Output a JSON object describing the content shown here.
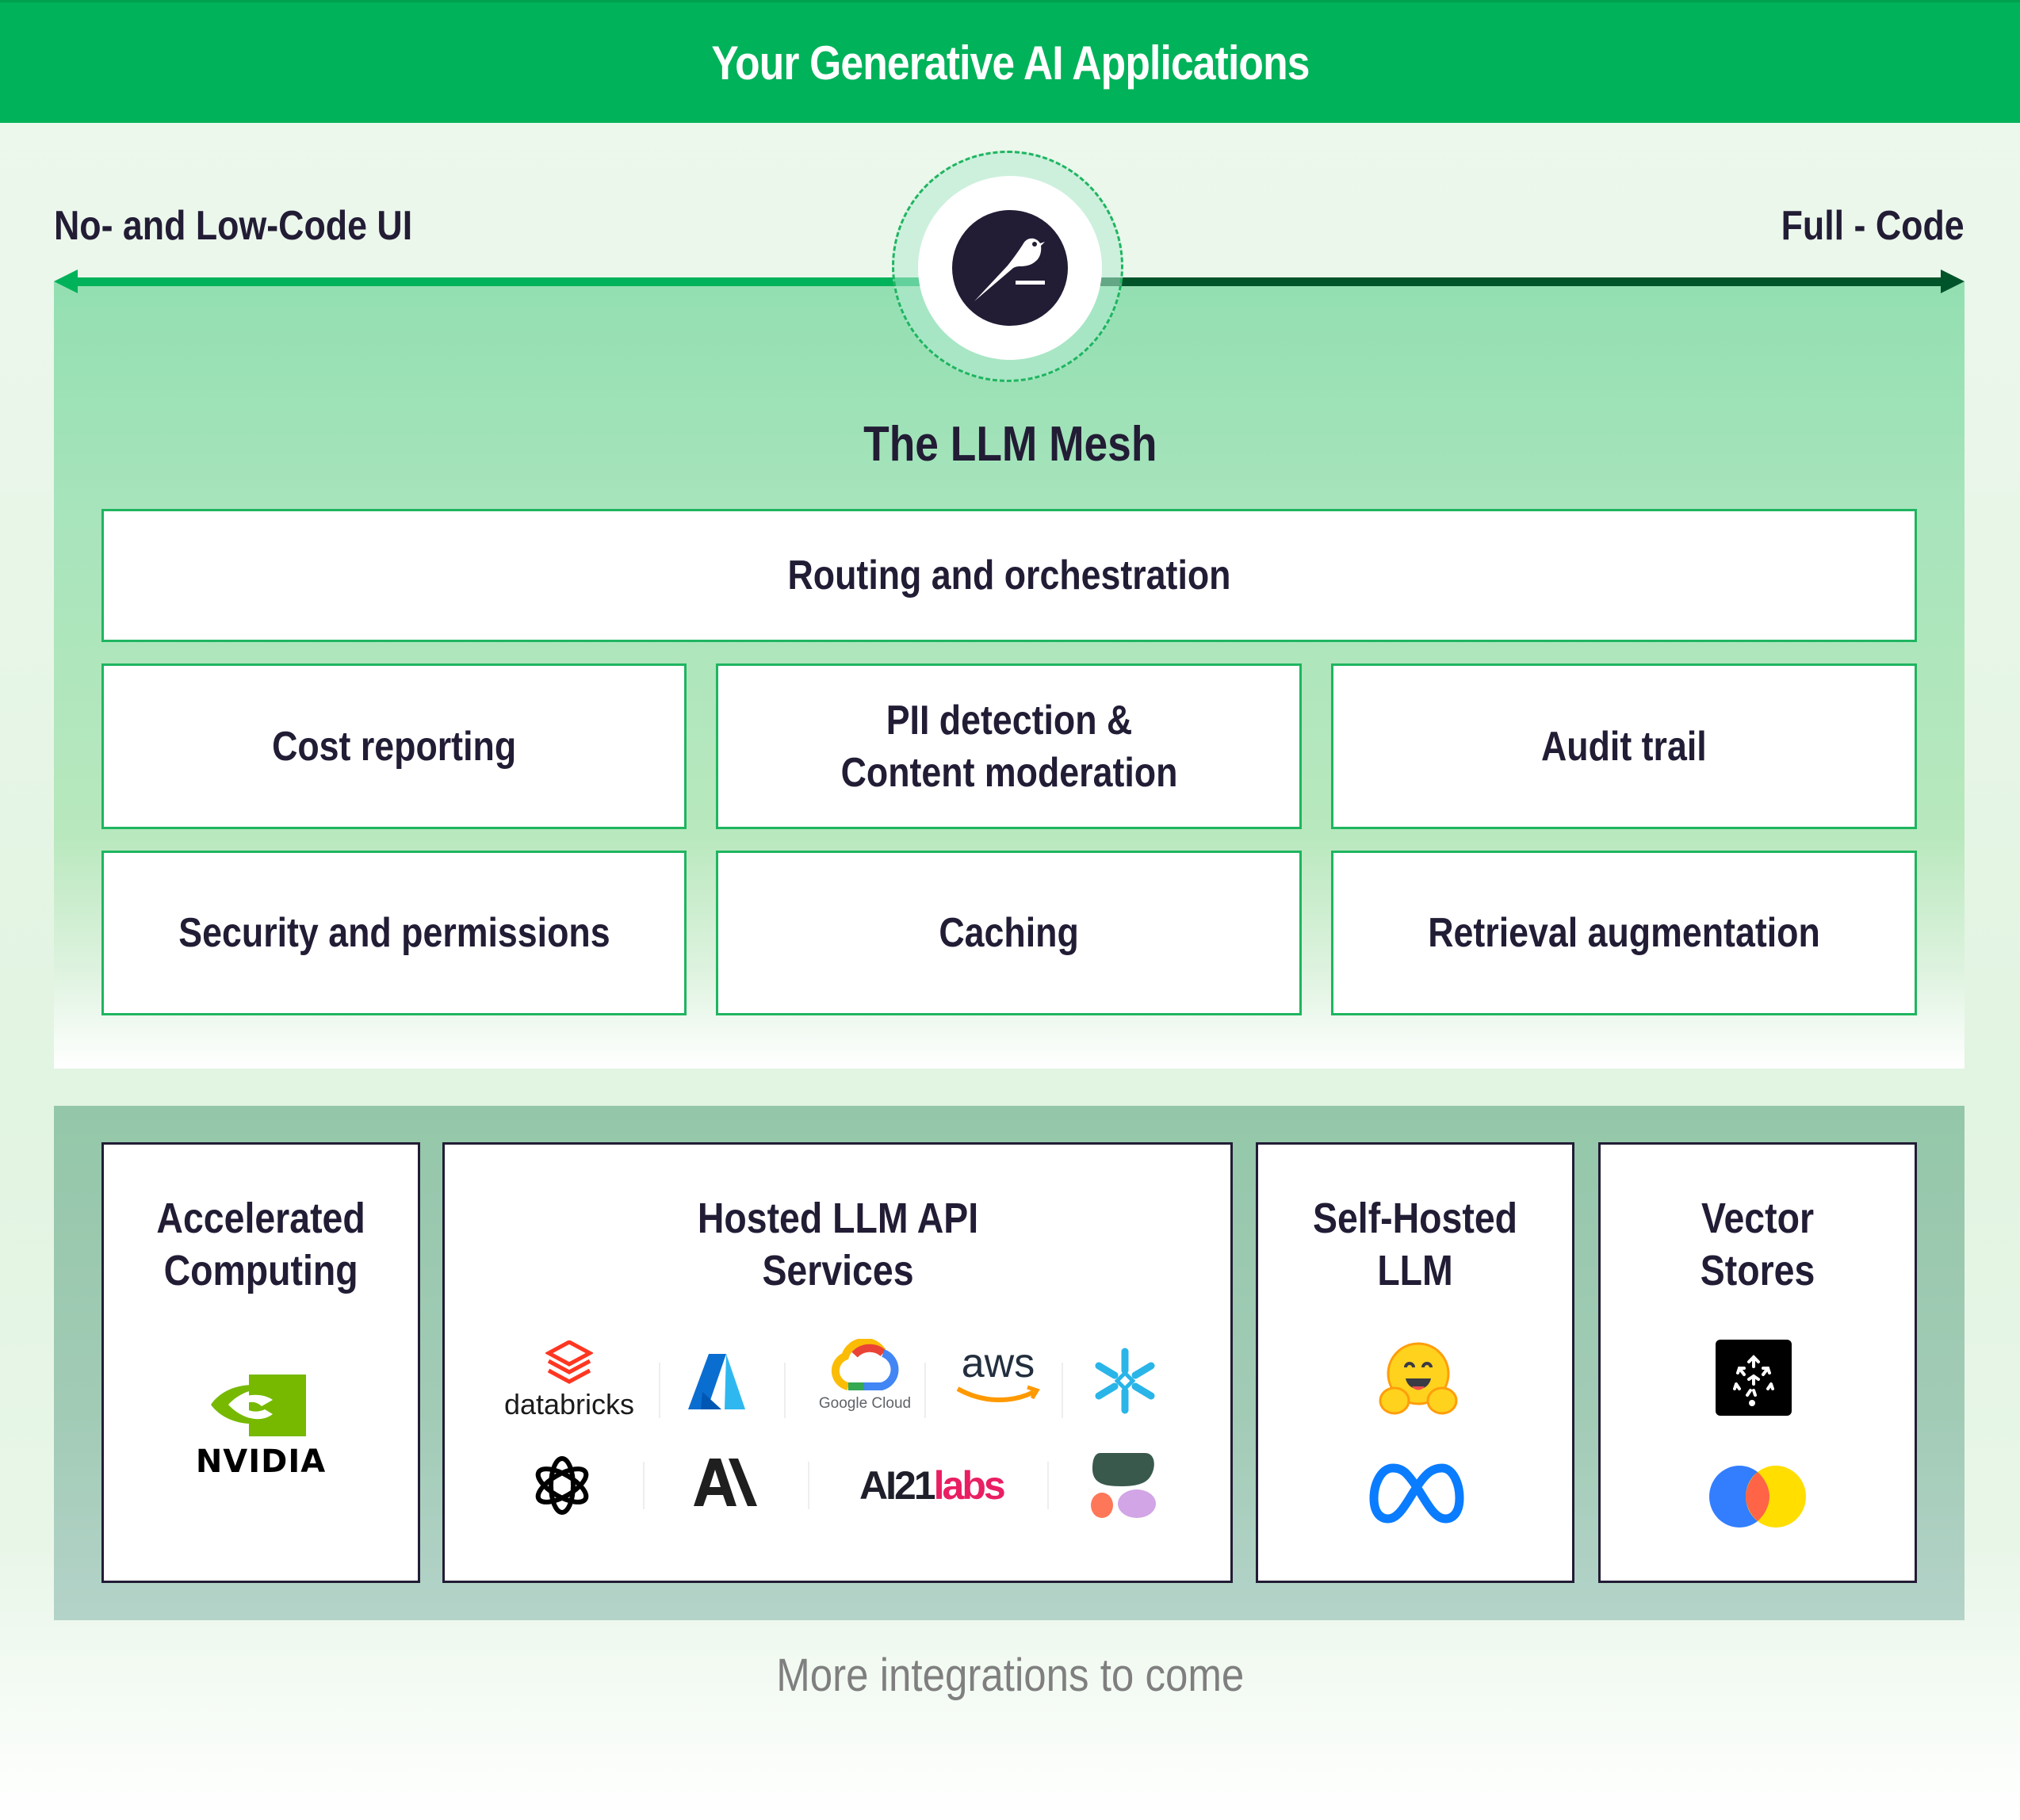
{
  "header": {
    "title": "Your Generative AI Applications"
  },
  "spectrum": {
    "left_label": "No- and Low-Code UI",
    "right_label": "Full - Code",
    "center_logo": "dataiku-bird-icon"
  },
  "mesh": {
    "title": "The LLM Mesh",
    "top_box": "Routing and orchestration",
    "grid": [
      "Cost reporting",
      "PII detection &\nContent moderation",
      "Audit trail",
      "Security and permissions",
      "Caching",
      "Retrieval augmentation"
    ]
  },
  "integrations": {
    "categories": [
      {
        "title": "Accelerated\nComputing",
        "logos": [
          "nvidia-logo"
        ],
        "logo_text": {
          "nvidia": "NVIDIA"
        }
      },
      {
        "title": "Hosted LLM API\nServices",
        "logos": [
          "databricks-logo",
          "azure-logo",
          "google-cloud-logo",
          "aws-logo",
          "snowflake-logo",
          "openai-logo",
          "anthropic-logo",
          "ai21-labs-logo",
          "cohere-logo"
        ],
        "logo_text": {
          "databricks": "databricks",
          "google_cloud": "Google Cloud",
          "aws": "aws",
          "ai21_a": "AI21",
          "ai21_b": "labs"
        }
      },
      {
        "title": "Self-Hosted\nLLM",
        "logos": [
          "hugging-face-logo",
          "meta-logo"
        ]
      },
      {
        "title": "Vector\nStores",
        "logos": [
          "pinecone-logo",
          "chroma-logo"
        ]
      }
    ]
  },
  "footer": {
    "text": "More integrations to come"
  },
  "colors": {
    "brand_green": "#00b259",
    "dark_green": "#00542a",
    "ink": "#221c35"
  }
}
